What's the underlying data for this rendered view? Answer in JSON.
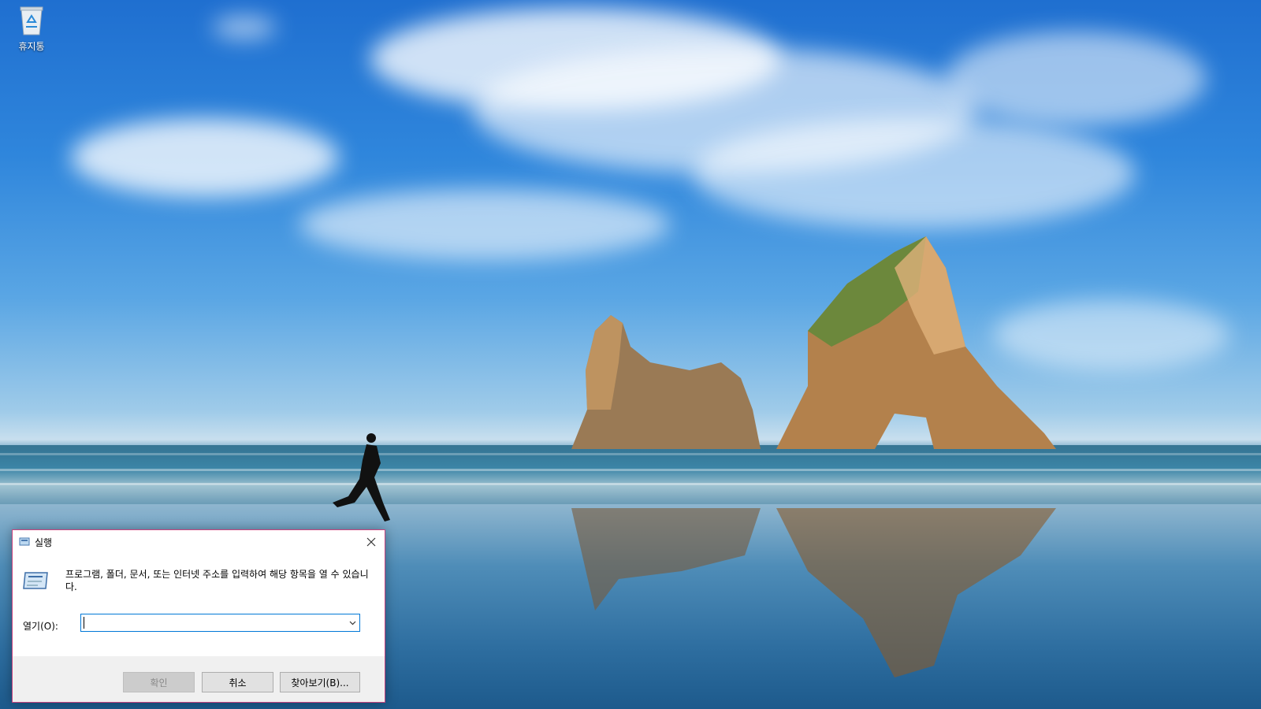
{
  "desktop": {
    "icons": [
      {
        "label": "휴지통"
      }
    ]
  },
  "run_dialog": {
    "title": "실행",
    "description": "프로그램, 폴더, 문서, 또는 인터넷 주소를 입력하여 해당 항목을 열 수 있습니다.",
    "open_label": "열기(O):",
    "open_value": "",
    "buttons": {
      "ok": "확인",
      "cancel": "취소",
      "browse": "찾아보기(B)..."
    }
  },
  "colors": {
    "dialog_border": "#c9437d",
    "input_focus": "#0078d7",
    "button_bar": "#f0f0f0"
  }
}
